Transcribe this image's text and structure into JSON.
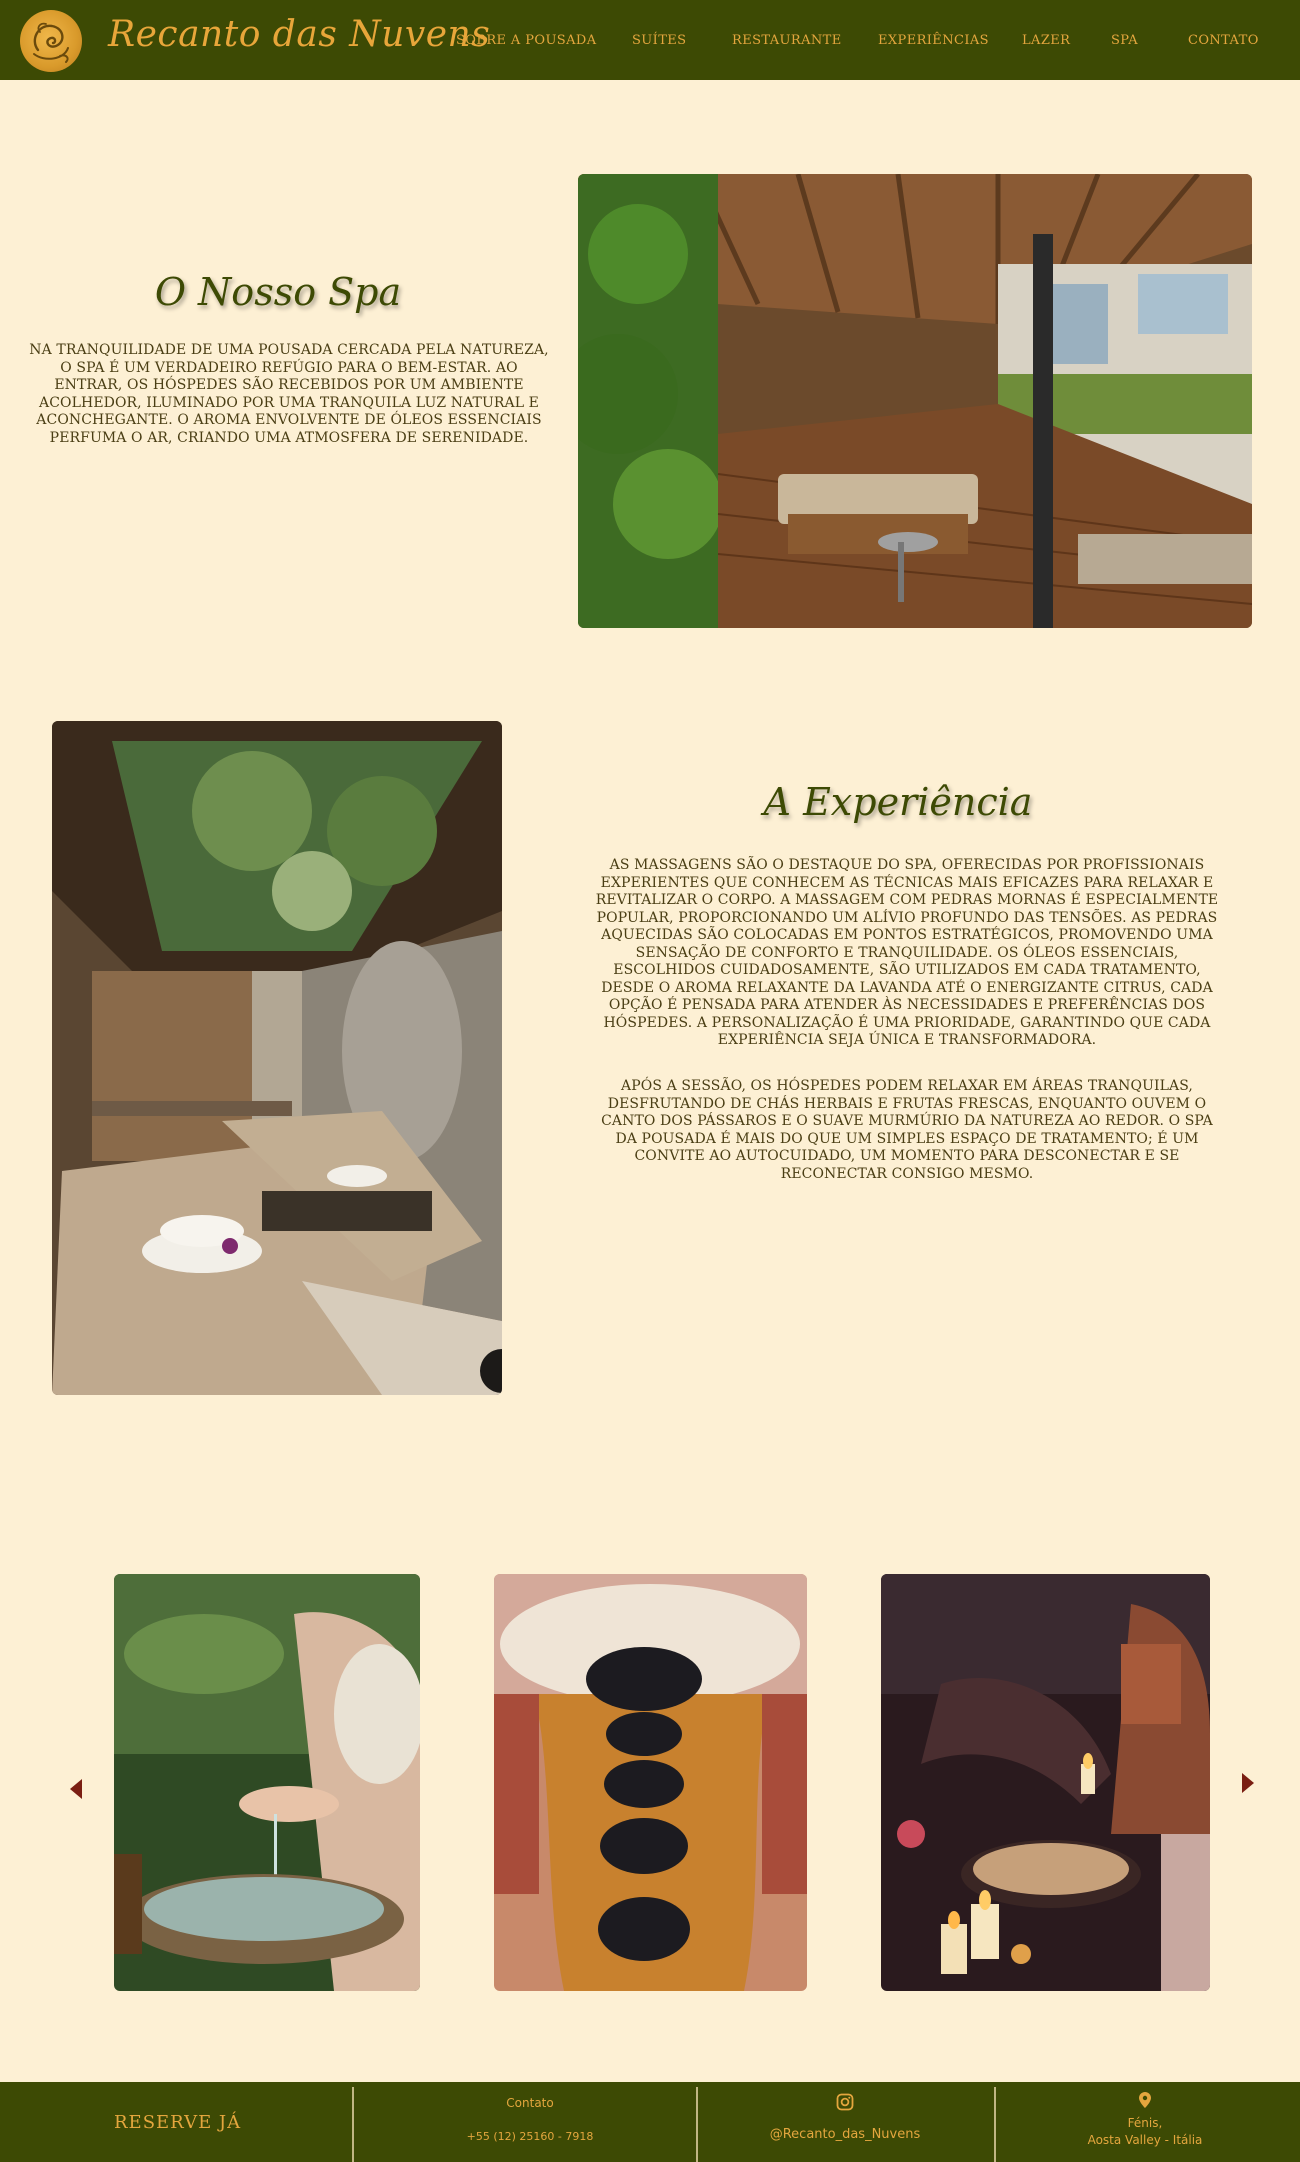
{
  "brand": {
    "name": "Recanto das Nuvens",
    "logo": "swirl-logo-icon"
  },
  "nav": {
    "items": [
      {
        "label": "SOBRE A POUSADA"
      },
      {
        "label": "SUÍTES"
      },
      {
        "label": "RESTAURANTE"
      },
      {
        "label": "EXPERIÊNCIAS"
      },
      {
        "label": "LAZER"
      },
      {
        "label": "SPA"
      },
      {
        "label": "CONTATO"
      }
    ]
  },
  "section1": {
    "title": "O Nosso Spa",
    "text": "Na tranquilidade de uma pousada cercada pela natureza, o spa é um verdadeiro refúgio para o bem-estar. Ao entrar, os hóspedes são recebidos por um ambiente acolhedor, iluminado por uma tranquila luz natural e aconchegante. O aroma envolvente de óleos essenciais perfuma o ar, criando uma atmosfera de serenidade."
  },
  "section2": {
    "title": "A Experiência",
    "text1": "As massagens são o destaque do spa, oferecidas por profissionais experientes que conhecem as técnicas mais eficazes para relaxar e revitalizar o corpo. A massagem com pedras mornas é especialmente popular, proporcionando um alívio profundo das tensões. As pedras aquecidas são colocadas em pontos estratégicos, promovendo uma sensação de conforto e tranquilidade. Os óleos essenciais, escolhidos cuidadosamente, são utilizados em cada tratamento, desde o aroma relaxante da lavanda até o energizante citrus, cada opção é pensada para atender às necessidades e preferências dos hóspedes. A personalização é uma prioridade, garantindo que cada experiência seja única e transformadora.",
    "text2": "Após a sessão, os hóspedes podem relaxar em áreas tranquilas, desfrutando de chás herbais e frutas frescas, enquanto ouvem o canto dos pássaros e o suave murmúrio da natureza ao redor. O spa da pousada é mais do que um simples espaço de tratamento; é um convite ao autocuidado, um momento para desconectar e se reconectar consigo mesmo."
  },
  "carousel": {
    "prev_icon": "triangle-left-icon",
    "next_icon": "triangle-right-icon"
  },
  "footer": {
    "reserve": "RESERVE JÁ",
    "contact_label": "Contato",
    "phone": "+55 (12) 25160 - 7918",
    "instagram_icon": "instagram-icon",
    "instagram": "@Recanto_das_Nuvens",
    "location_icon": "map-pin-icon",
    "location_line1": "Fénis,",
    "location_line2": "Aosta Valley -  Itália"
  },
  "colors": {
    "header_bg": "#3D4A04",
    "page_bg": "#FDF0D4",
    "accent": "#E4A63E",
    "arrow": "#7A1E12"
  }
}
